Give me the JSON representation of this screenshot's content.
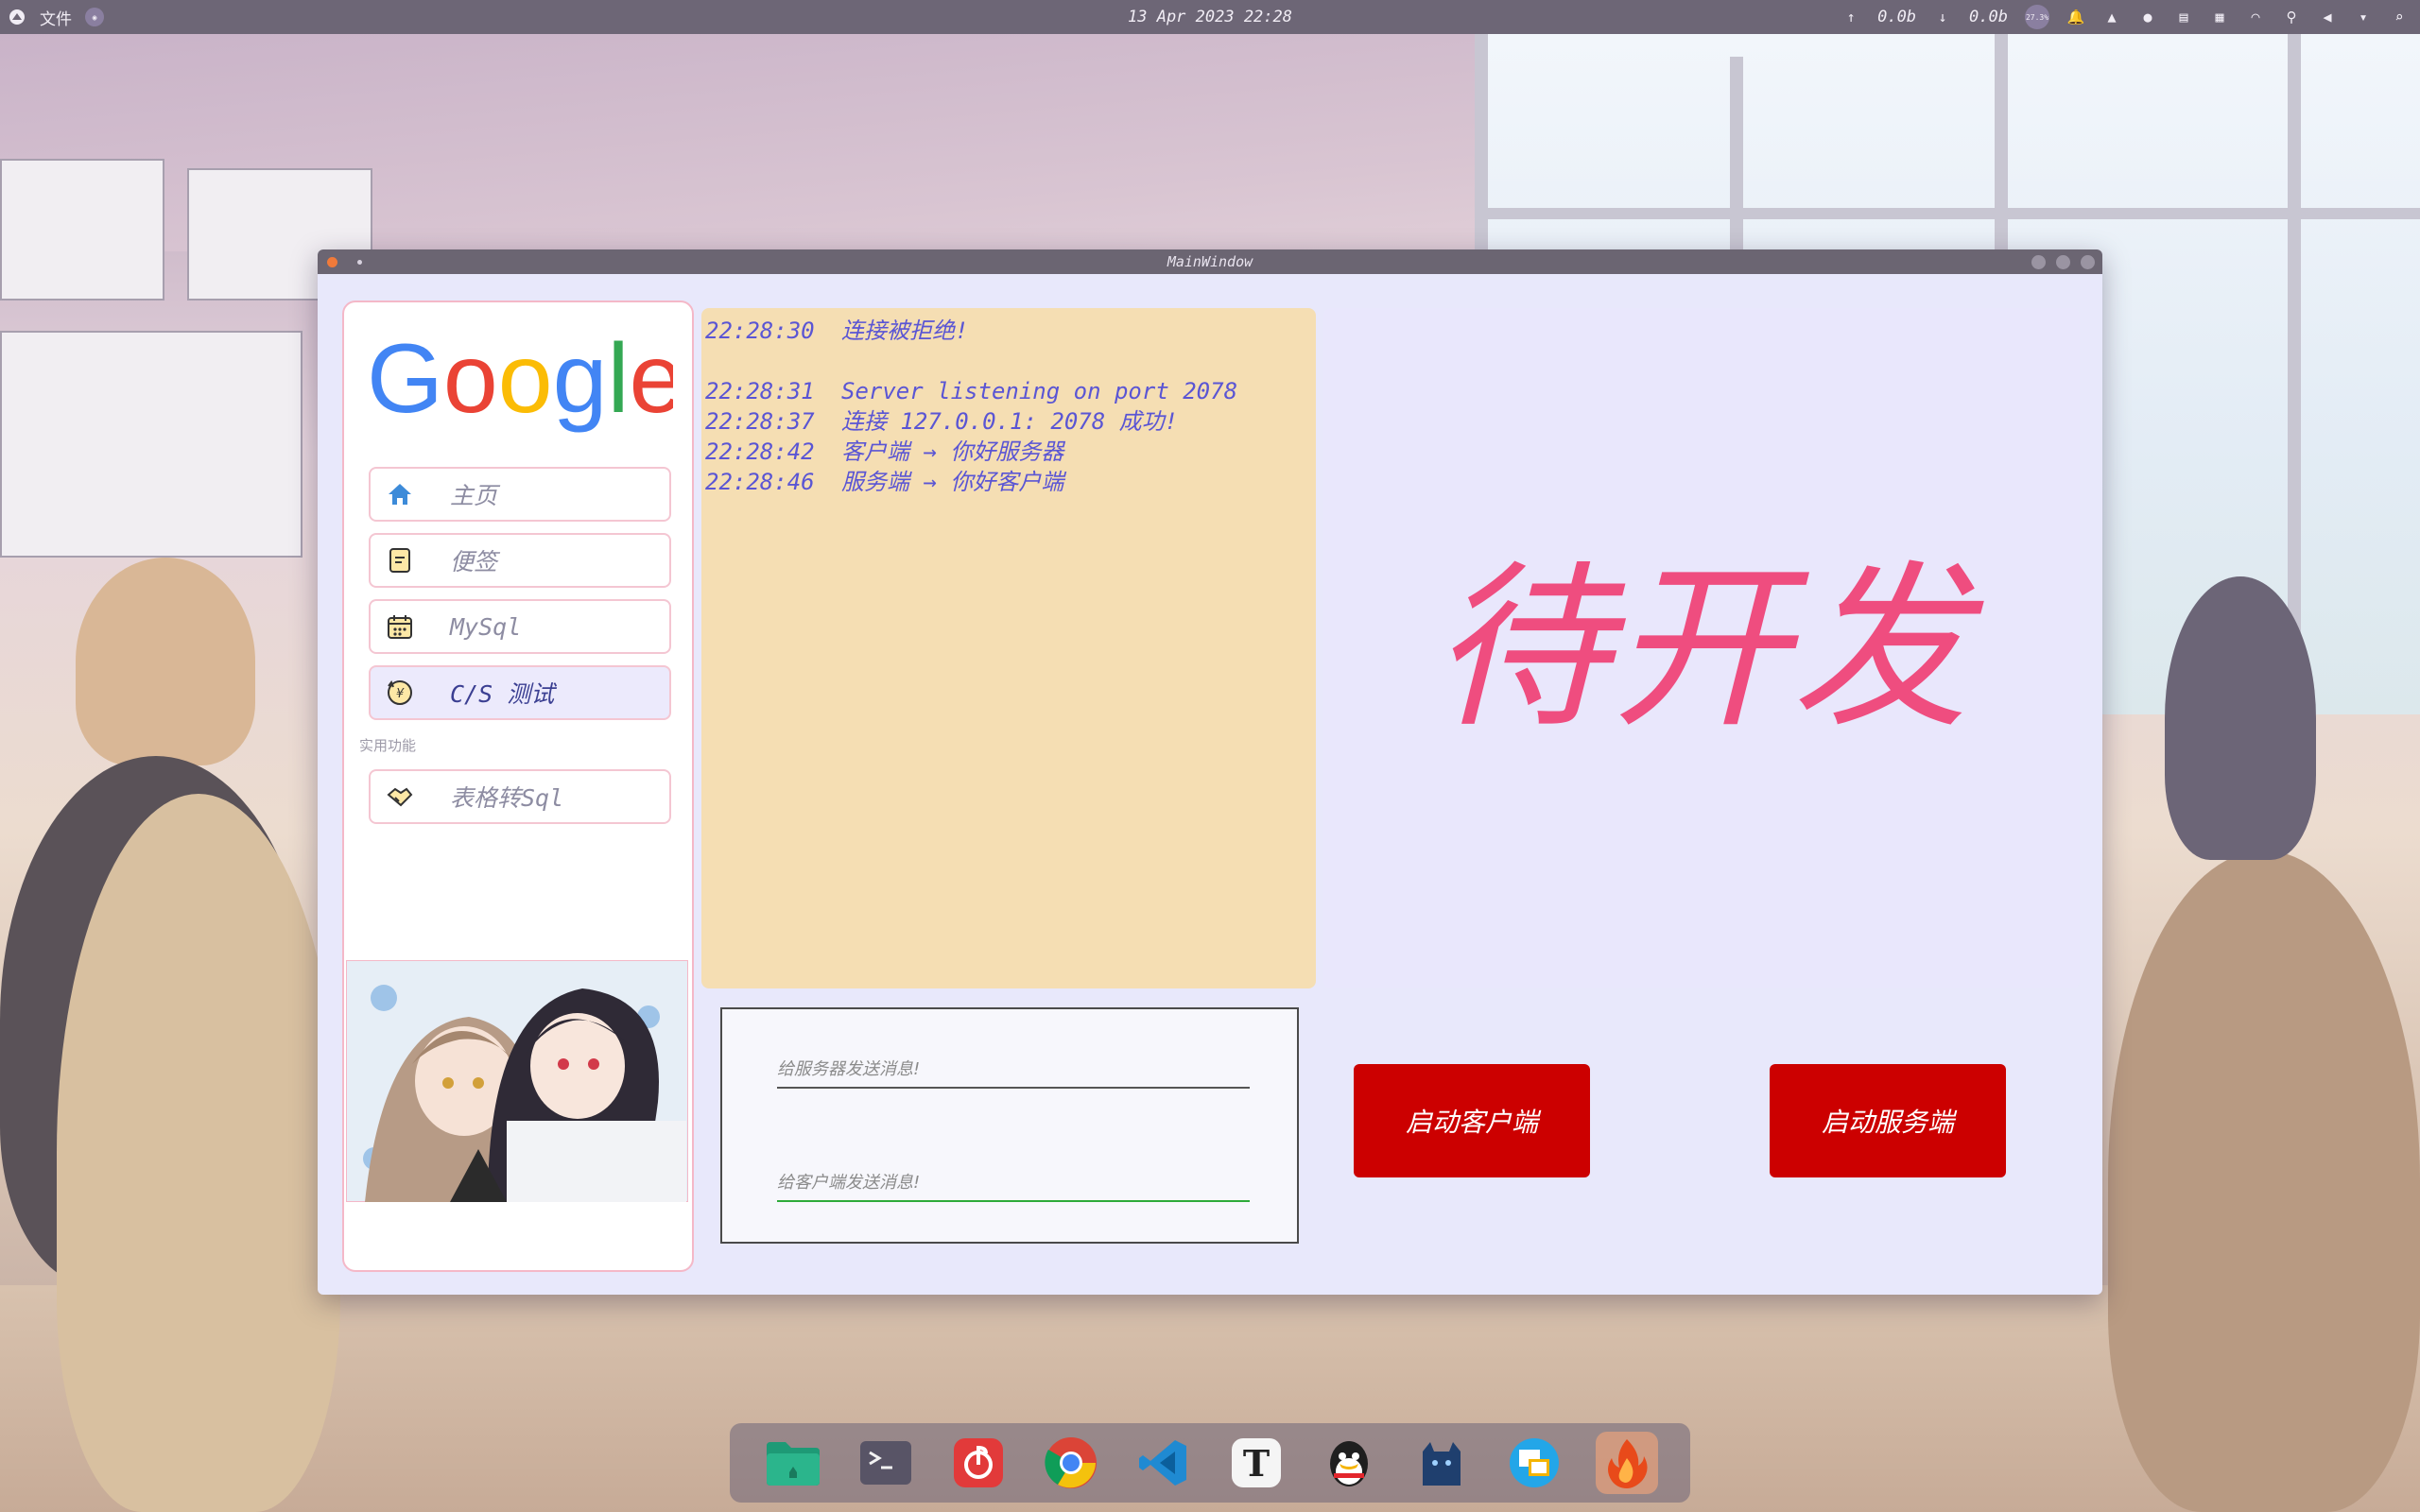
{
  "topbar": {
    "activities_label": "文件",
    "datetime": "13 Apr 2023 22:28",
    "upload_speed": "0.0b",
    "download_speed": "0.0b",
    "cpu_badge": "27.3%"
  },
  "window": {
    "title": "MainWindow"
  },
  "sidebar": {
    "logo_text": "Google",
    "items": [
      {
        "label": "主页",
        "icon": "home-icon"
      },
      {
        "label": "便签",
        "icon": "note-icon"
      },
      {
        "label": "MySql",
        "icon": "calendar-icon"
      },
      {
        "label": "C/S 测试",
        "icon": "yen-refresh-icon",
        "active": true
      }
    ],
    "section_label": "实用功能",
    "utility_items": [
      {
        "label": "表格转Sql",
        "icon": "handshake-icon"
      }
    ]
  },
  "log": {
    "lines": [
      {
        "time": "22:28:30",
        "text": "连接被拒绝!"
      },
      {
        "time": "",
        "text": ""
      },
      {
        "time": "22:28:31",
        "text": "Server listening on port 2078"
      },
      {
        "time": "22:28:37",
        "text": "连接 127.0.0.1: 2078 成功!"
      },
      {
        "time": "22:28:42",
        "text": "客户端 → 你好服务器"
      },
      {
        "time": "22:28:46",
        "text": "服务端 → 你好客户端"
      }
    ]
  },
  "placeholder_panel": {
    "text": "待开发"
  },
  "messages": {
    "to_server_placeholder": "给服务器发送消息!",
    "to_client_placeholder": "给客户端发送消息!"
  },
  "buttons": {
    "start_client": "启动客户端",
    "start_server": "启动服务端"
  },
  "colors": {
    "accent_red": "#cc0000",
    "placeholder_pink": "#ef4d7f",
    "log_bg": "#f5deb3",
    "log_text": "#5a55d4",
    "panel_lavender": "#e9e7fc"
  },
  "dock": {
    "items": [
      "folder-icon",
      "terminal-icon",
      "netease-music-icon",
      "chrome-icon",
      "vscode-icon",
      "typora-icon",
      "qq-icon",
      "cat-app-icon",
      "remote-desktop-icon",
      "fire-app-icon"
    ]
  }
}
